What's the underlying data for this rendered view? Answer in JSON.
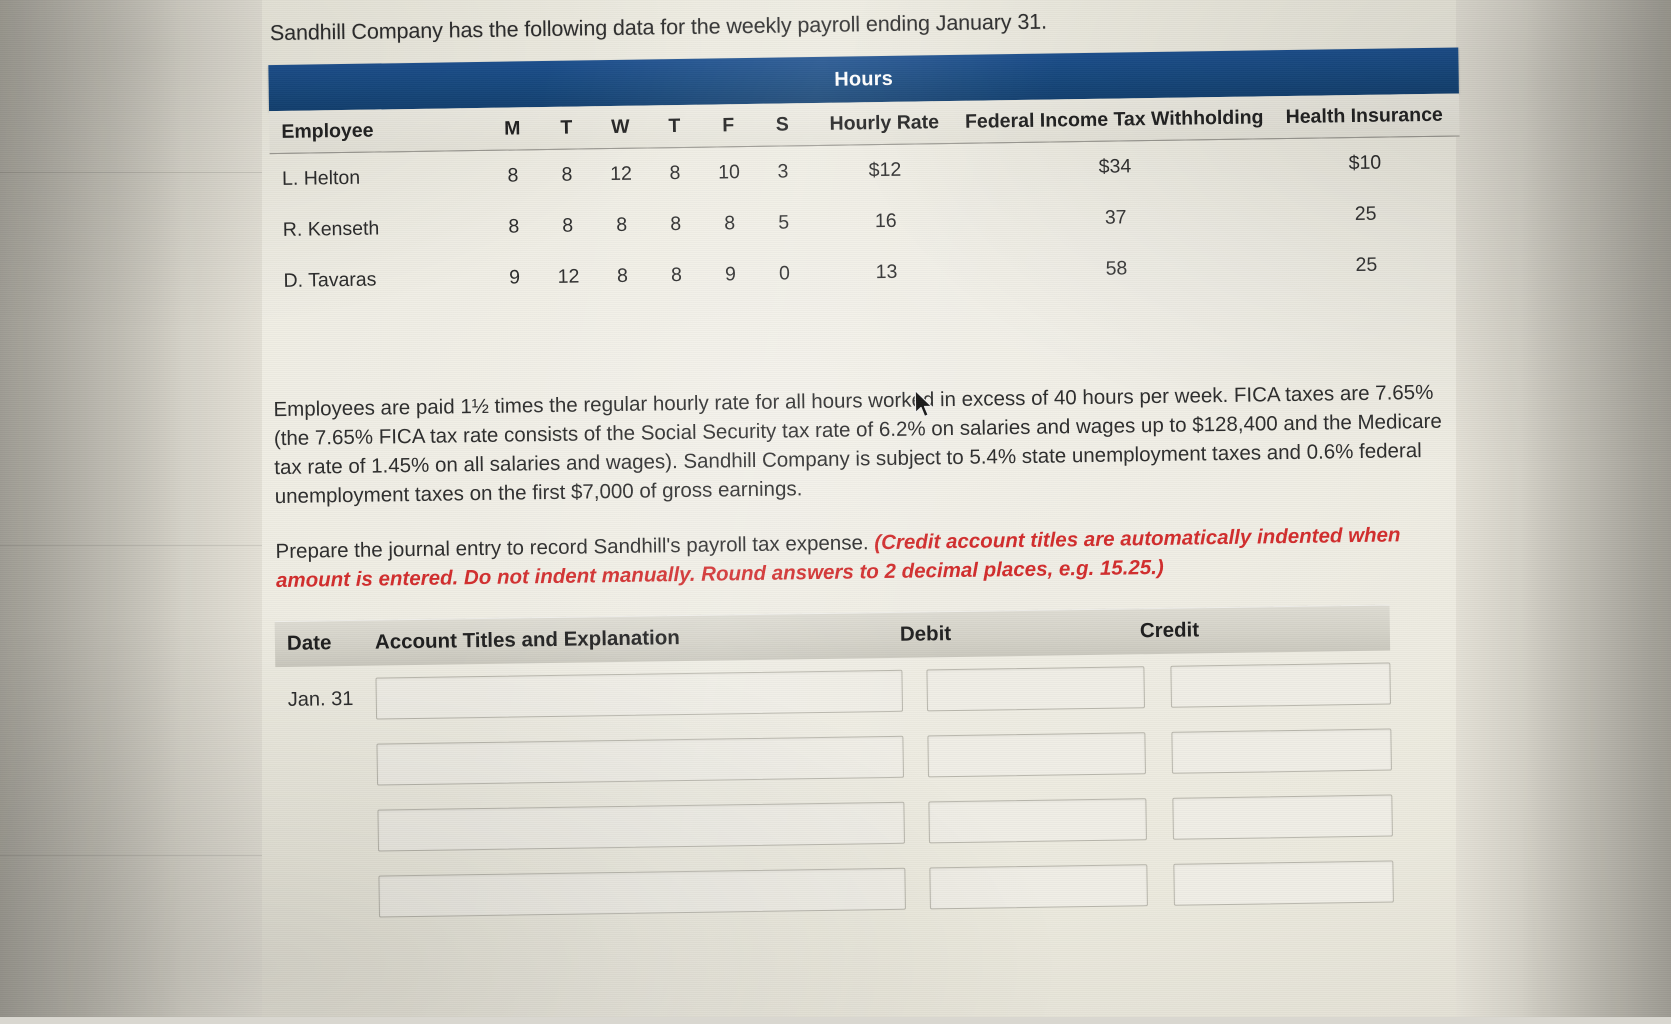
{
  "prompt": "Sandhill Company has the following data for the weekly payroll ending January 31.",
  "payroll_table": {
    "group_header": "Hours",
    "columns": {
      "employee": "Employee",
      "mon": "M",
      "tue": "T",
      "wed": "W",
      "thu": "T",
      "fri": "F",
      "sat": "S",
      "hourly_rate": "Hourly Rate",
      "federal": "Federal Income Tax Withholding",
      "health": "Health Insurance"
    },
    "rows": [
      {
        "employee": "L. Helton",
        "mon": "8",
        "tue": "8",
        "wed": "12",
        "thu": "8",
        "fri": "10",
        "sat": "3",
        "hourly_rate": "$12",
        "federal": "$34",
        "health": "$10"
      },
      {
        "employee": "R. Kenseth",
        "mon": "8",
        "tue": "8",
        "wed": "8",
        "thu": "8",
        "fri": "8",
        "sat": "5",
        "hourly_rate": "16",
        "federal": "37",
        "health": "25"
      },
      {
        "employee": "D. Tavaras",
        "mon": "9",
        "tue": "12",
        "wed": "8",
        "thu": "8",
        "fri": "9",
        "sat": "0",
        "hourly_rate": "13",
        "federal": "58",
        "health": "25"
      }
    ]
  },
  "body_paragraph": "Employees are paid 1½ times the regular hourly rate for all hours worked in excess of 40 hours per week. FICA taxes are 7.65% (the 7.65% FICA tax rate consists of the Social Security tax rate of 6.2% on salaries and wages up to $128,400 and the Medicare tax rate of 1.45% on all salaries and wages). Sandhill Company is subject to 5.4% state unemployment taxes and 0.6% federal unemployment taxes on the first $7,000 of gross earnings.",
  "question": {
    "lead": "Prepare the journal entry to record Sandhill's payroll tax expense. ",
    "note": "(Credit account titles are automatically indented when amount is entered. Do not indent manually. Round answers to 2 decimal places, e.g. 15.25.)"
  },
  "journal_table": {
    "columns": {
      "date": "Date",
      "account": "Account Titles and Explanation",
      "debit": "Debit",
      "credit": "Credit"
    },
    "rows": [
      {
        "date": "Jan. 31",
        "account": "",
        "debit": "",
        "credit": ""
      },
      {
        "date": "",
        "account": "",
        "debit": "",
        "credit": ""
      },
      {
        "date": "",
        "account": "",
        "debit": "",
        "credit": ""
      },
      {
        "date": "",
        "account": "",
        "debit": "",
        "credit": ""
      }
    ]
  },
  "colors": {
    "hours_band": "#17497f",
    "instruction_red": "#d22d2d",
    "journal_header": "#d4d2c8",
    "page_background": "#eceade"
  },
  "cursor": {
    "icon": "mouse-pointer-icon"
  }
}
